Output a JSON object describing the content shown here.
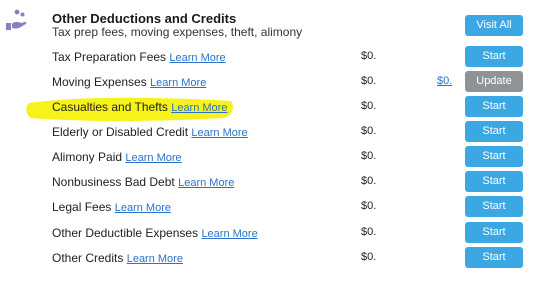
{
  "section": {
    "title": "Other Deductions and Credits",
    "subtitle": "Tax prep fees, moving expenses, theft, alimony",
    "visit_all_label": "Visit All"
  },
  "learn_more_label": "Learn More",
  "rows": [
    {
      "label": "Tax Preparation Fees",
      "amount": "$0.",
      "link_amount": "",
      "button": "Start"
    },
    {
      "label": "Moving Expenses",
      "amount": "$0.",
      "link_amount": "$0.",
      "button": "Update"
    },
    {
      "label": "Casualties and Thefts",
      "amount": "$0.",
      "link_amount": "",
      "button": "Start"
    },
    {
      "label": "Elderly or Disabled Credit",
      "amount": "$0.",
      "link_amount": "",
      "button": "Start"
    },
    {
      "label": "Alimony Paid",
      "amount": "$0.",
      "link_amount": "",
      "button": "Start"
    },
    {
      "label": "Nonbusiness Bad Debt",
      "amount": "$0.",
      "link_amount": "",
      "button": "Start"
    },
    {
      "label": "Legal Fees",
      "amount": "$0.",
      "link_amount": "",
      "button": "Start"
    },
    {
      "label": "Other Deductible Expenses",
      "amount": "$0.",
      "link_amount": "",
      "button": "Start"
    },
    {
      "label": "Other Credits",
      "amount": "$0.",
      "link_amount": "",
      "button": "Start"
    }
  ],
  "colors": {
    "button_blue": "#3ba8e4",
    "button_gray": "#8f9396",
    "link_blue": "#2a72c9",
    "highlight_yellow": "#f7f21a",
    "icon_purple": "#8a7fc0"
  },
  "icons": {
    "section": "hand-coins-icon"
  }
}
